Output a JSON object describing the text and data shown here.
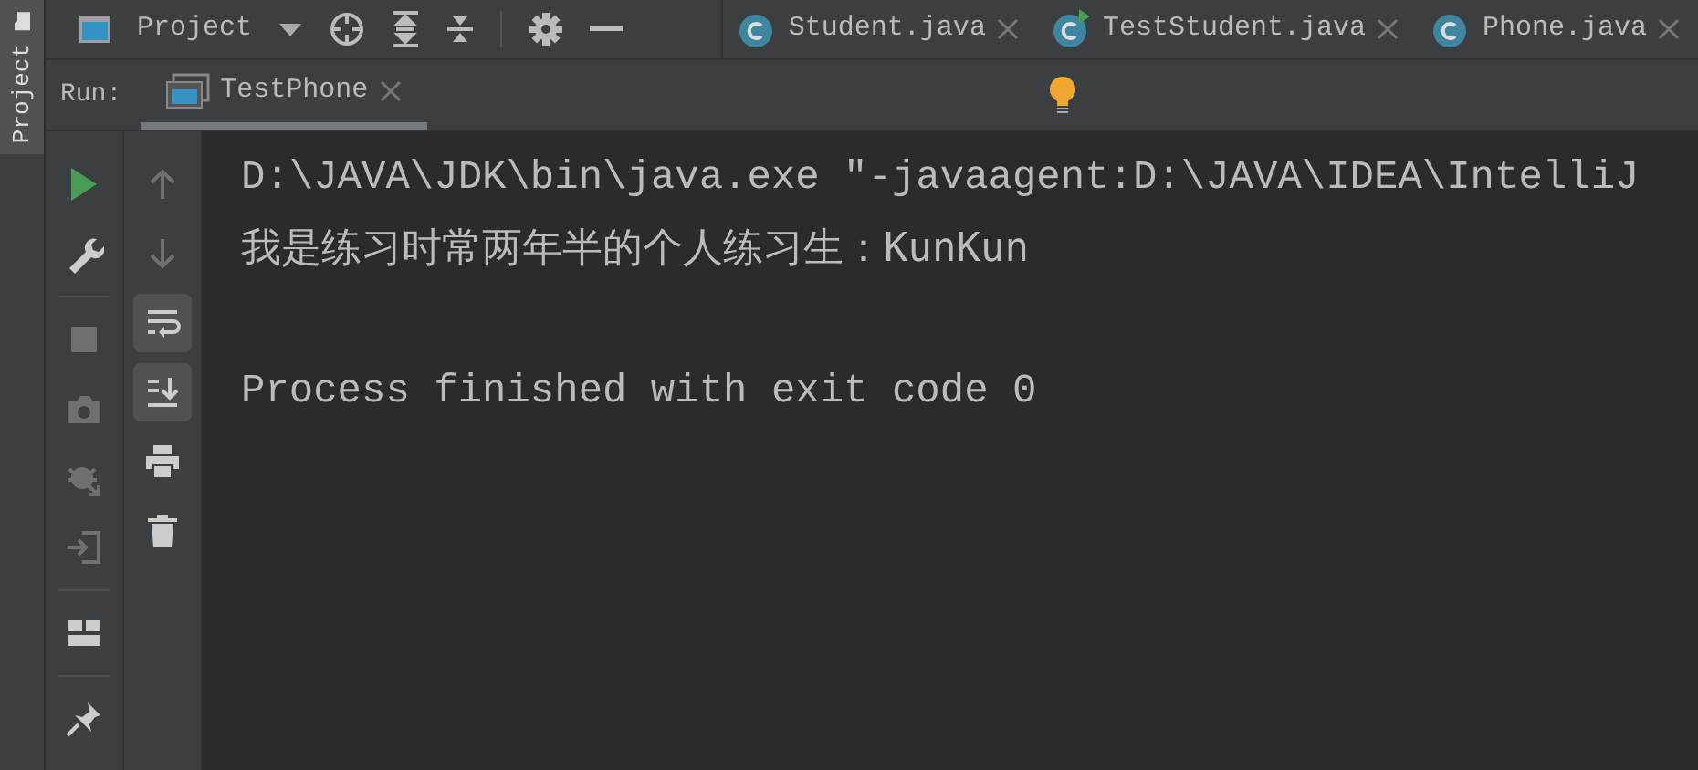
{
  "side_strip": {
    "label": "Project"
  },
  "project_toolbar": {
    "title": "Project"
  },
  "editor_tabs": [
    {
      "label": "Student.java",
      "run_marker": false
    },
    {
      "label": "TestStudent.java",
      "run_marker": true
    },
    {
      "label": "Phone.java",
      "run_marker": false
    }
  ],
  "run_bar": {
    "label": "Run:",
    "tab": {
      "label": "TestPhone",
      "selected": true
    }
  },
  "left_toolbar": [
    {
      "kind": "run",
      "disabled": false
    },
    {
      "kind": "wrench",
      "disabled": false
    },
    {
      "kind": "separator"
    },
    {
      "kind": "stop",
      "disabled": true
    },
    {
      "kind": "camera",
      "disabled": true
    },
    {
      "kind": "debug",
      "disabled": true
    },
    {
      "kind": "exit",
      "disabled": true
    },
    {
      "kind": "separator"
    },
    {
      "kind": "layout",
      "disabled": false
    },
    {
      "kind": "separator"
    },
    {
      "kind": "pin",
      "disabled": false
    }
  ],
  "right_toolbar": [
    {
      "kind": "up",
      "disabled": true,
      "on": false
    },
    {
      "kind": "down",
      "disabled": true,
      "on": false
    },
    {
      "kind": "wrap",
      "disabled": false,
      "on": true
    },
    {
      "kind": "scroll",
      "disabled": false,
      "on": true
    },
    {
      "kind": "print",
      "disabled": false,
      "on": false
    },
    {
      "kind": "trash",
      "disabled": false,
      "on": false
    }
  ],
  "console": {
    "lines": [
      "D:\\JAVA\\JDK\\bin\\java.exe \"-javaagent:D:\\JAVA\\IDEA\\IntelliJ",
      "我是练习时常两年半的个人练习生：KunKun"
    ],
    "exit_message": "Process finished with exit code 0"
  }
}
